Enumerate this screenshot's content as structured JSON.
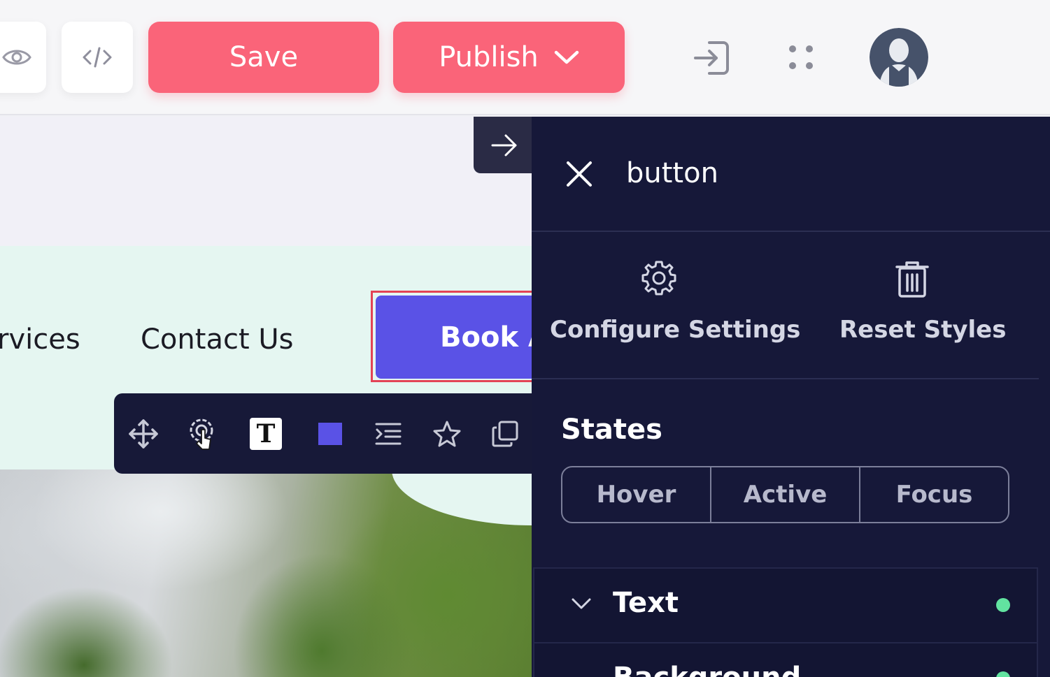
{
  "topbar": {
    "save_label": "Save",
    "publish_label": "Publish",
    "icons": {
      "preview": "eye-icon",
      "code": "code-icon",
      "exit": "sign-in-icon",
      "apps": "grid-dots-icon",
      "user": "avatar"
    }
  },
  "canvas": {
    "nav_items": [
      "rvices",
      "Contact Us"
    ],
    "cta_label": "Book A"
  },
  "element_toolbar": {
    "tools": [
      "move-icon",
      "settings-icon",
      "text-icon",
      "color-swatch",
      "indent-icon",
      "star-icon",
      "duplicate-icon"
    ],
    "text_tool_glyph": "T",
    "swatch_color": "#5a52e6"
  },
  "panel": {
    "title": "button",
    "actions": {
      "configure_label": "Configure Settings",
      "reset_label": "Reset Styles"
    },
    "states_title": "States",
    "states": [
      "Hover",
      "Active",
      "Focus"
    ],
    "sections": [
      {
        "label": "Text",
        "status_color": "#62e3a0"
      },
      {
        "label": "Background",
        "status_color": "#62e3a0"
      }
    ]
  },
  "colors": {
    "accent": "#fa6479",
    "cta": "#5a52e6",
    "panel_bg": "#161839",
    "selection": "#e34356",
    "status_ok": "#62e3a0"
  }
}
